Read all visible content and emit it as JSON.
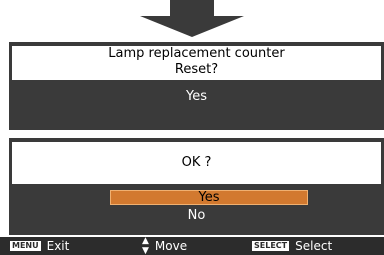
{
  "confirm_dialog": {
    "line1": "Lamp replacement counter",
    "line2": "Reset?",
    "choice": "Yes"
  },
  "ok_dialog": {
    "question": "OK ?",
    "options": [
      "Yes",
      "No"
    ],
    "selected": "Yes"
  },
  "hints": {
    "exit_key": "MENU",
    "exit_label": "Exit",
    "move_icon": "up-down-arrows-icon",
    "move_label": "Move",
    "select_key": "SELECT",
    "select_label": "Select"
  },
  "colors": {
    "highlight": "#d2792f",
    "panel": "#3a3a3a",
    "bar": "#2c2c2c"
  }
}
